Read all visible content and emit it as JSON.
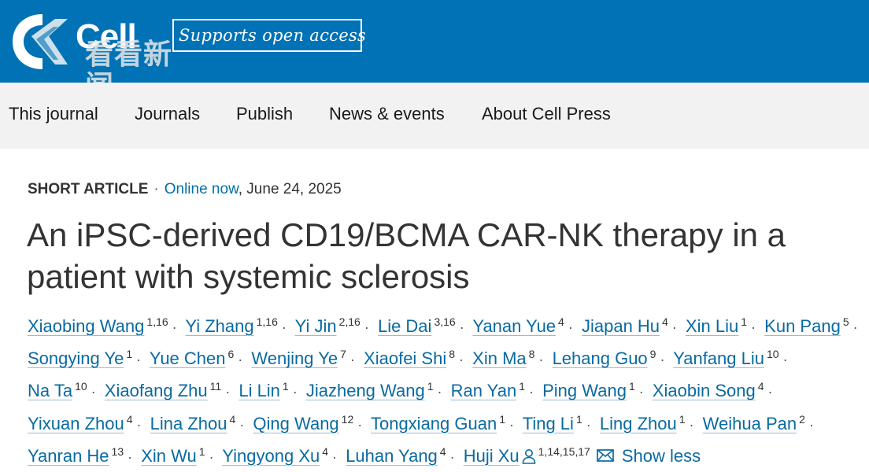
{
  "header": {
    "brand": "Cell",
    "watermark": "看看新闻",
    "open_access": "Supports open access",
    "brand_color": "#0072b5"
  },
  "nav": {
    "items": [
      {
        "label": "This journal"
      },
      {
        "label": "Journals"
      },
      {
        "label": "Publish"
      },
      {
        "label": "News & events"
      },
      {
        "label": "About Cell Press"
      }
    ]
  },
  "article": {
    "type": "SHORT ARTICLE",
    "online_label": "Online now",
    "date": ", June 24, 2025",
    "title": "An iPSC-derived CD19/BCMA CAR-NK therapy in a patient with systemic sclerosis",
    "authors": [
      {
        "name": "Xiaobing Wang",
        "aff": "1,16"
      },
      {
        "name": "Yi Zhang",
        "aff": "1,16"
      },
      {
        "name": "Yi Jin",
        "aff": "2,16"
      },
      {
        "name": "Lie Dai",
        "aff": "3,16"
      },
      {
        "name": "Yanan Yue",
        "aff": "4"
      },
      {
        "name": "Jiapan Hu",
        "aff": "4"
      },
      {
        "name": "Xin Liu",
        "aff": "1"
      },
      {
        "name": "Kun Pang",
        "aff": "5"
      },
      {
        "name": "Songying Ye",
        "aff": "1"
      },
      {
        "name": "Yue Chen",
        "aff": "6"
      },
      {
        "name": "Wenjing Ye",
        "aff": "7"
      },
      {
        "name": "Xiaofei Shi",
        "aff": "8"
      },
      {
        "name": "Xin Ma",
        "aff": "8"
      },
      {
        "name": "Lehang Guo",
        "aff": "9"
      },
      {
        "name": "Yanfang Liu",
        "aff": "10"
      },
      {
        "name": "Na Ta",
        "aff": "10"
      },
      {
        "name": "Xiaofang Zhu",
        "aff": "11"
      },
      {
        "name": "Li Lin",
        "aff": "1"
      },
      {
        "name": "Jiazheng Wang",
        "aff": "1"
      },
      {
        "name": "Ran Yan",
        "aff": "1"
      },
      {
        "name": "Ping Wang",
        "aff": "1"
      },
      {
        "name": "Xiaobin Song",
        "aff": "4"
      },
      {
        "name": "Yixuan Zhou",
        "aff": "4"
      },
      {
        "name": "Lina Zhou",
        "aff": "4"
      },
      {
        "name": "Qing Wang",
        "aff": "12"
      },
      {
        "name": "Tongxiang Guan",
        "aff": "1"
      },
      {
        "name": "Ting Li",
        "aff": "1"
      },
      {
        "name": "Ling Zhou",
        "aff": "1"
      },
      {
        "name": "Weihua Pan",
        "aff": "2"
      },
      {
        "name": "Yanran He",
        "aff": "13"
      },
      {
        "name": "Xin Wu",
        "aff": "1"
      },
      {
        "name": "Yingyong Xu",
        "aff": "4"
      },
      {
        "name": "Luhan Yang",
        "aff": "4"
      }
    ],
    "corresponding_author": {
      "name": "Huji Xu",
      "aff": "1,14,15,17"
    },
    "show_less_label": "Show less",
    "separator": "·"
  }
}
